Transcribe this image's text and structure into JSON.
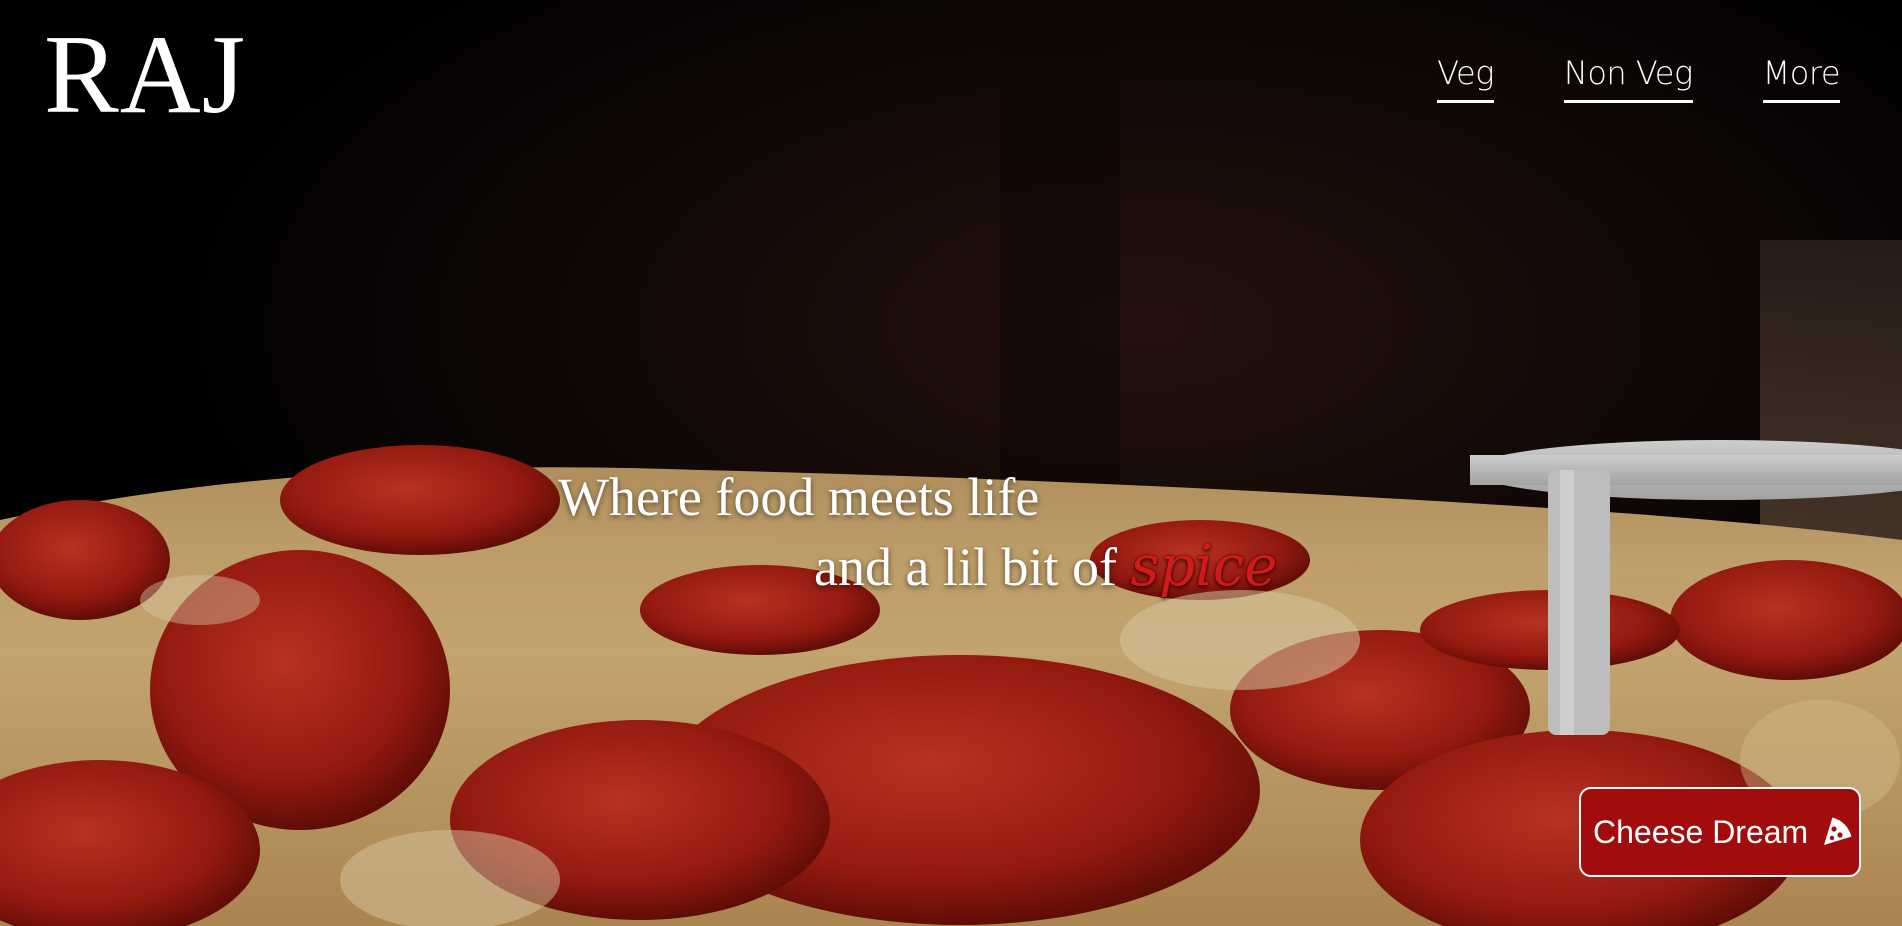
{
  "brand": {
    "logo_text": "RAJ"
  },
  "nav": {
    "items": [
      {
        "label": "Veg"
      },
      {
        "label": "Non Veg"
      },
      {
        "label": "More"
      }
    ]
  },
  "hero": {
    "tagline_line1": "Where food meets life",
    "tagline_line2_prefix": "and a lil bit of ",
    "tagline_highlight": "spice",
    "cta_label": "Cheese Dream",
    "cta_icon": "pizza-slice-icon"
  },
  "colors": {
    "accent_red": "#a30c0c",
    "spice_red": "#d11b1b",
    "text": "#ffffff"
  }
}
